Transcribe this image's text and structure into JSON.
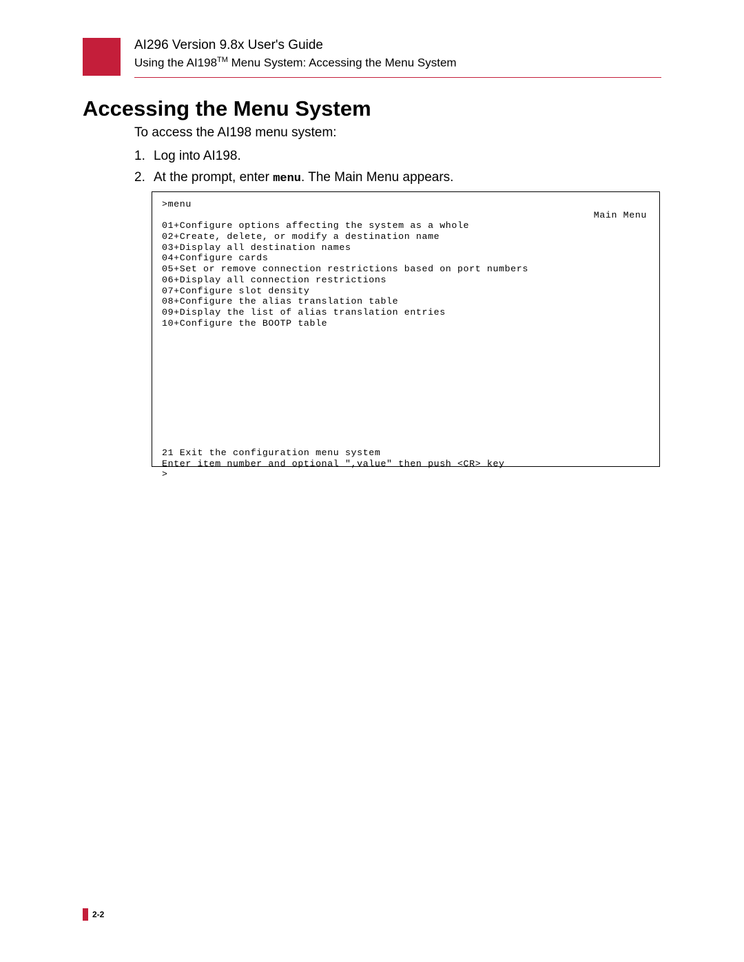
{
  "header": {
    "title": "AI296 Version 9.8x User's Guide",
    "subtitle_prefix": "Using the AI198",
    "subtitle_tm": "TM",
    "subtitle_suffix": " Menu System: Accessing the Menu System"
  },
  "heading": "Accessing the Menu System",
  "intro": "To access the AI198 menu system:",
  "steps": [
    {
      "num": "1.",
      "text": "Log into AI198."
    },
    {
      "num": "2.",
      "prefix": "At the prompt, enter ",
      "cmd": "menu",
      "suffix": ". The Main Menu appears."
    }
  ],
  "terminal": {
    "prompt_line": ">menu",
    "header_right": "Main Menu",
    "items": [
      "01+Configure options affecting the system as a whole",
      "02+Create, delete, or modify a destination name",
      "03+Display all destination names",
      "04+Configure cards",
      "05+Set or remove connection restrictions based on port numbers",
      "06+Display all connection restrictions",
      "07+Configure slot density",
      "08+Configure the alias translation table",
      "09+Display the list of alias translation entries",
      "10+Configure the BOOTP table"
    ],
    "exit_line": "21 Exit the configuration menu system",
    "instr_line": "Enter item number and optional \",value\" then push <CR> key",
    "final_prompt": ">"
  },
  "footer": {
    "page": "2-2"
  }
}
